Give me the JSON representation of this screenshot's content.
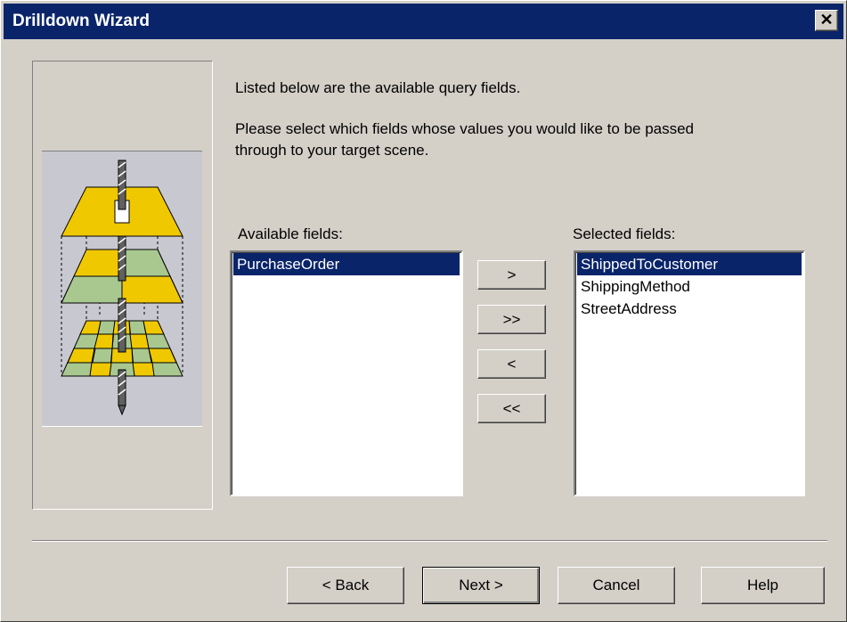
{
  "window": {
    "title": "Drilldown Wizard",
    "close_glyph": "✕"
  },
  "instructions": {
    "line1": "Listed below are the available query fields.",
    "line2a": "Please select which fields whose values you would like to be passed",
    "line2b": "through to your target scene."
  },
  "available": {
    "label": "Available fields:",
    "items": [
      "PurchaseOrder"
    ],
    "selected_index": 0
  },
  "selected": {
    "label": "Selected fields:",
    "items": [
      "ShippedToCustomer",
      "ShippingMethod",
      "StreetAddress"
    ],
    "selected_index": 0
  },
  "move_buttons": {
    "add": ">",
    "add_all": ">>",
    "remove": "<",
    "remove_all": "<<"
  },
  "footer": {
    "back": "< Back",
    "next": "Next >",
    "cancel": "Cancel",
    "help": "Help"
  },
  "colors": {
    "title_bar": "#0a246a",
    "face": "#d4d0c8",
    "selection": "#0a246a",
    "layer_yellow": "#f0c800",
    "layer_green": "#a8c890"
  },
  "icons": {
    "wizard_art": "drilldown-layers-illustration",
    "close": "close-icon"
  }
}
